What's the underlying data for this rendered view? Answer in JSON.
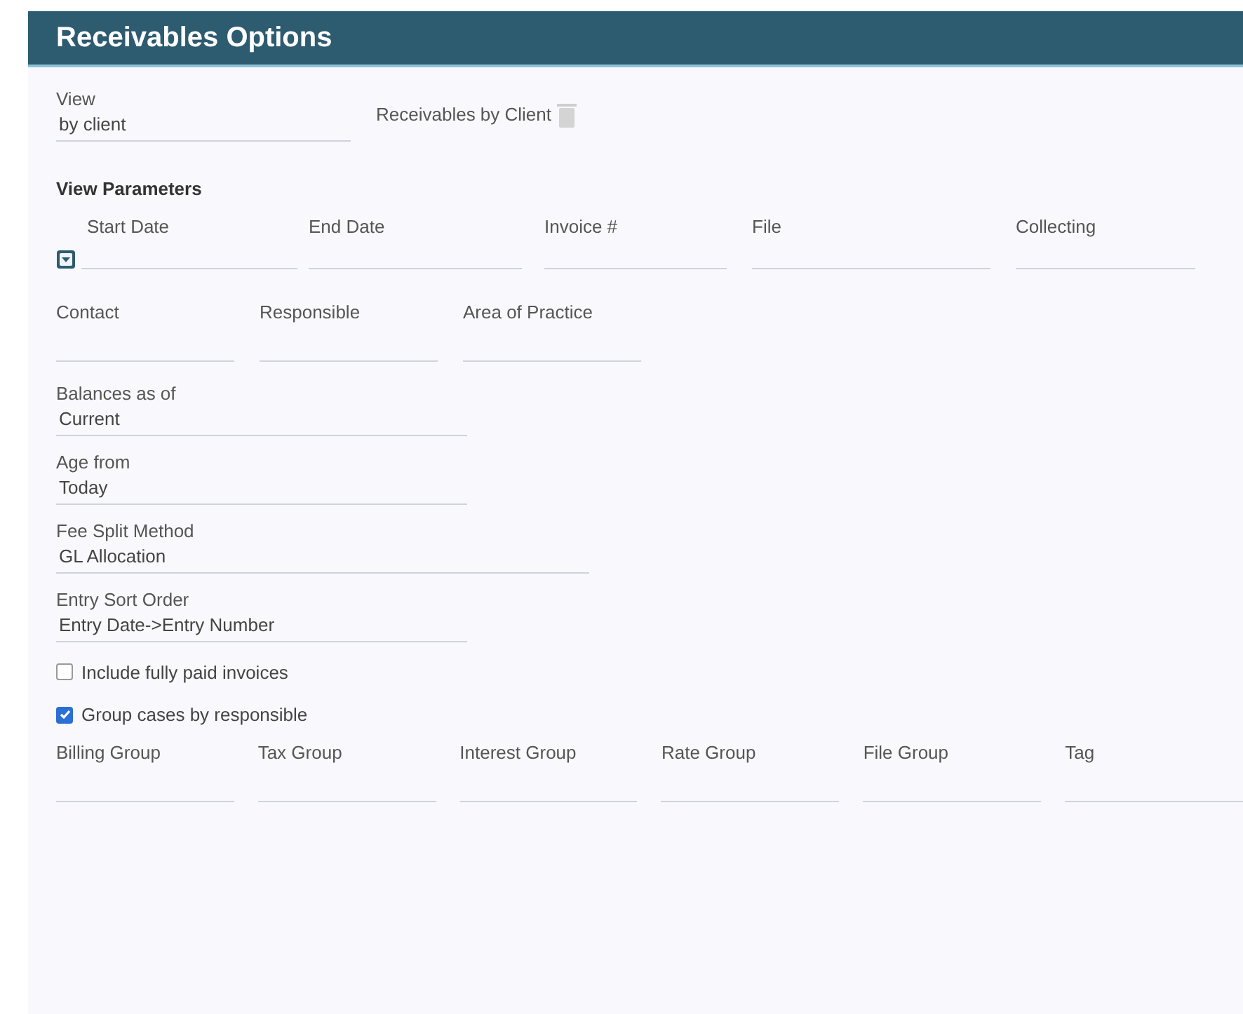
{
  "header": {
    "title": "Receivables Options"
  },
  "view": {
    "label": "View",
    "value": "by client",
    "report_name": "Receivables by Client"
  },
  "parameters": {
    "title": "View Parameters",
    "date_row": [
      {
        "label": "Start Date",
        "kind": "toggle"
      },
      {
        "label": "End Date",
        "kind": "plain"
      },
      {
        "label": "Invoice #",
        "kind": "plain"
      },
      {
        "label": "File",
        "kind": "plain"
      },
      {
        "label": "Collecting",
        "kind": "plain"
      }
    ],
    "people_row": [
      {
        "label": "Contact"
      },
      {
        "label": "Responsible"
      },
      {
        "label": "Area of Practice"
      }
    ],
    "selects": [
      {
        "label": "Balances as of",
        "value": "Current"
      },
      {
        "label": "Age from",
        "value": "Today"
      },
      {
        "label": "Fee Split Method",
        "value": "GL Allocation"
      },
      {
        "label": "Entry Sort Order",
        "value": "Entry Date->Entry Number"
      }
    ],
    "checkboxes": [
      {
        "label": "Include fully paid invoices",
        "checked": false
      },
      {
        "label": "Group cases by responsible",
        "checked": true
      }
    ],
    "group_row": [
      {
        "label": "Billing Group"
      },
      {
        "label": "Tax Group"
      },
      {
        "label": "Interest Group"
      },
      {
        "label": "Rate Group"
      },
      {
        "label": "File Group"
      },
      {
        "label": "Tag"
      }
    ]
  }
}
